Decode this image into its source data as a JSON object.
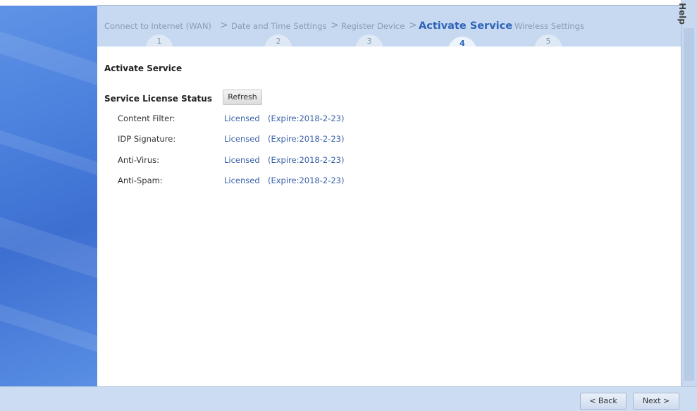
{
  "steps": [
    {
      "label": "Connect to Internet (WAN)",
      "num": "1"
    },
    {
      "label": "Date and Time Settings",
      "num": "2"
    },
    {
      "label": "Register Device",
      "num": "3"
    },
    {
      "label": "Activate Service",
      "num": "4"
    },
    {
      "label": "Wireless Settings",
      "num": "5"
    }
  ],
  "step_separator": ">",
  "active_step_index": 3,
  "page_title": "Activate Service",
  "license_section": {
    "label": "Service License Status",
    "refresh_label": "Refresh",
    "rows": [
      {
        "name": "Content Filter:",
        "status": "Licensed",
        "expire": "(Expire:2018-2-23)"
      },
      {
        "name": "IDP Signature:",
        "status": "Licensed",
        "expire": "(Expire:2018-2-23)"
      },
      {
        "name": "Anti-Virus:",
        "status": "Licensed",
        "expire": "(Expire:2018-2-23)"
      },
      {
        "name": "Anti-Spam:",
        "status": "Licensed",
        "expire": "(Expire:2018-2-23)"
      }
    ]
  },
  "help_label": "Help",
  "nav": {
    "back_label": "< Back",
    "next_label": "Next >"
  },
  "colors": {
    "accent": "#2e63b8",
    "link": "#3a62a7",
    "step_bar": "#c7d9f0",
    "side_panel": "#4a7fdc"
  }
}
